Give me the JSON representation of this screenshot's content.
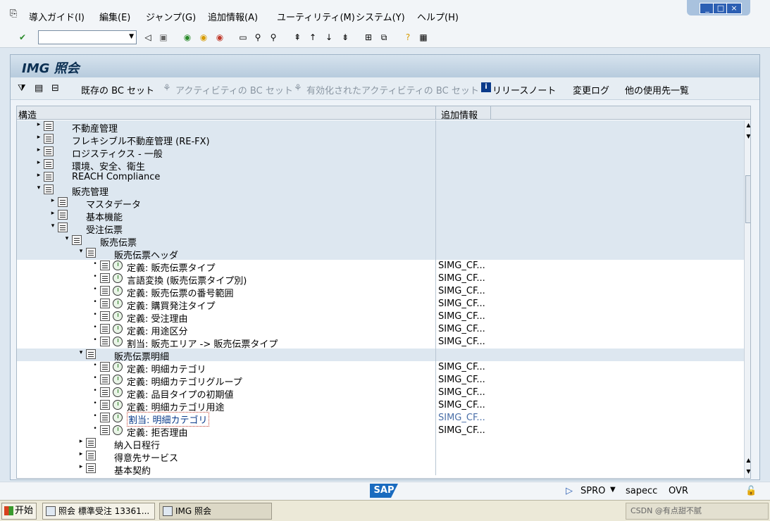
{
  "menubar": {
    "items": [
      "導入ガイド(I)",
      "編集(E)",
      "ジャンプ(G)",
      "追加情報(A)",
      "ユーティリティ(M)",
      "システム(Y)",
      "ヘルプ(H)"
    ]
  },
  "window_controls": [
    "_",
    "□",
    "×"
  ],
  "toolbar": {
    "command_value": ""
  },
  "panel": {
    "title": "IMG 照会",
    "app_toolbar": {
      "existing_bc_sets": "既存の BC セット",
      "activity_bc_sets": "アクティビティの BC セット",
      "activated_activity_bc_sets": "有効化されたアクティビティの BC セット",
      "release_notes": "リリースノート",
      "change_log": "変更ログ",
      "other_usage": "他の使用先一覧"
    }
  },
  "tree": {
    "col_structure": "構造",
    "col_info": "追加情報",
    "rows": [
      {
        "label": "不動産管理",
        "info": ""
      },
      {
        "label": "フレキシブル不動産管理 (RE-FX)",
        "info": ""
      },
      {
        "label": "ロジスティクス - 一般",
        "info": ""
      },
      {
        "label": "環境、安全、衛生",
        "info": ""
      },
      {
        "label": "REACH Compliance",
        "info": ""
      },
      {
        "label": "販売管理",
        "info": ""
      },
      {
        "label": "マスタデータ",
        "info": ""
      },
      {
        "label": "基本機能",
        "info": ""
      },
      {
        "label": "受注伝票",
        "info": ""
      },
      {
        "label": "販売伝票",
        "info": ""
      },
      {
        "label": "販売伝票ヘッダ",
        "info": ""
      },
      {
        "label": "定義: 販売伝票タイプ",
        "info": "SIMG_CF..."
      },
      {
        "label": "言語変換 (販売伝票タイプ別)",
        "info": "SIMG_CF..."
      },
      {
        "label": "定義: 販売伝票の番号範囲",
        "info": "SIMG_CF..."
      },
      {
        "label": "定義: 購買発注タイプ",
        "info": "SIMG_CF..."
      },
      {
        "label": "定義: 受注理由",
        "info": "SIMG_CF..."
      },
      {
        "label": "定義: 用途区分",
        "info": "SIMG_CF..."
      },
      {
        "label": "割当: 販売エリア -> 販売伝票タイプ",
        "info": "SIMG_CF..."
      },
      {
        "label": "販売伝票明細",
        "info": ""
      },
      {
        "label": "定義: 明細カテゴリ",
        "info": "SIMG_CF..."
      },
      {
        "label": "定義: 明細カテゴリグループ",
        "info": "SIMG_CF..."
      },
      {
        "label": "定義: 品目タイプの初期値",
        "info": "SIMG_CF..."
      },
      {
        "label": "定義: 明細カテゴリ用途",
        "info": "SIMG_CF..."
      },
      {
        "label": "割当: 明細カテゴリ",
        "info": "SIMG_CF..."
      },
      {
        "label": "定義: 拒否理由",
        "info": "SIMG_CF..."
      },
      {
        "label": "納入日程行",
        "info": ""
      },
      {
        "label": "得意先サービス",
        "info": ""
      },
      {
        "label": "基本契約",
        "info": ""
      }
    ]
  },
  "status": {
    "sap_logo": "SAP",
    "transaction": "SPRO",
    "server": "sapecc",
    "mode": "OVR"
  },
  "taskbar": {
    "start": "开始",
    "task1": "照会 標準受注 13361...",
    "task2": "IMG 照会",
    "tray": "CSDN @有点甜不腻"
  }
}
